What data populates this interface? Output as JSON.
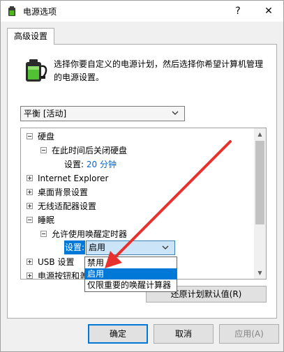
{
  "window": {
    "title": "电源选项",
    "help": "?",
    "close": "✕"
  },
  "tab": {
    "label": "高级设置"
  },
  "description": "选择你要自定义的电源计划，然后选择你希望计算机管理的电源设置。",
  "plan_select": {
    "value": "平衡 [活动]"
  },
  "tree": {
    "hard_disk": "硬盘",
    "turn_off_disk_after": "在此时间后关闭硬盘",
    "disk_setting_label": "设置:",
    "disk_setting_value": "20 分钟",
    "internet_explorer": "Internet Explorer",
    "desktop_background": "桌面背景设置",
    "wireless_adapter": "无线适配器设置",
    "sleep": "睡眠",
    "allow_wake_timers": "允许使用唤醒定时器",
    "wake_setting_label": "设置:",
    "wake_setting_value": "启用",
    "usb_settings": "USB 设置",
    "power_buttons": "电源按钮和盖子"
  },
  "dropdown": {
    "options": [
      "禁用",
      "启用",
      "仅限重要的唤醒计算器"
    ],
    "selected_index": 1
  },
  "buttons": {
    "restore_defaults": "还原计划默认值(R)",
    "ok": "确定",
    "cancel": "取消",
    "apply": "应用(A)"
  },
  "colors": {
    "accent": "#0078d7",
    "arrow": "#e8302c",
    "value_text": "#0066cc"
  },
  "icons": [
    "battery-power-icon",
    "help-icon",
    "close-icon",
    "chevron-down-icon"
  ]
}
